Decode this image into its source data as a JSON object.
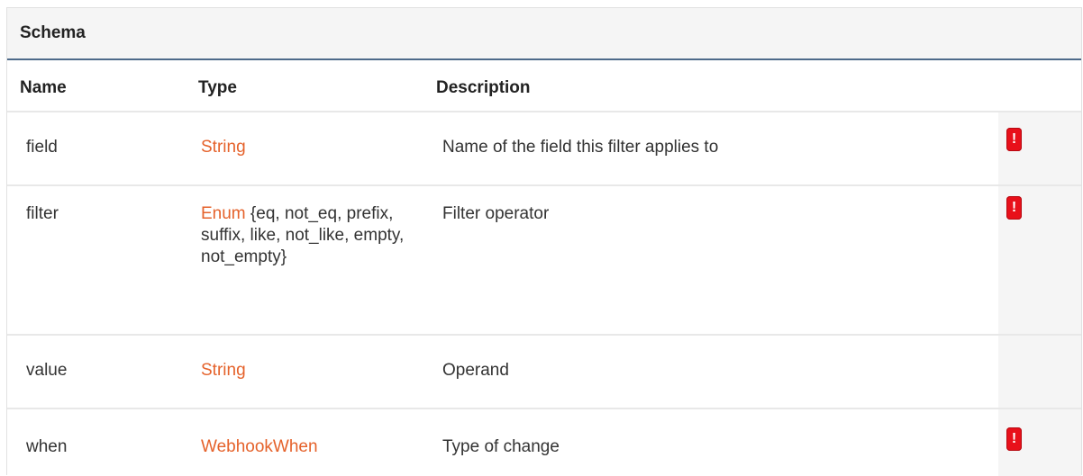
{
  "schema": {
    "title": "Schema",
    "columns": {
      "name": "Name",
      "type": "Type",
      "description": "Description"
    },
    "rows": [
      {
        "name": "field",
        "type_link": "String",
        "type_extra": "",
        "description": "Name of the field this filter applies to",
        "required_badge": "!"
      },
      {
        "name": "filter",
        "type_link": "Enum",
        "type_extra": " {eq, not_eq, prefix, suffix, like, not_like, empty, not_empty}",
        "description": "Filter operator",
        "required_badge": "!"
      },
      {
        "name": "value",
        "type_link": "String",
        "type_extra": "",
        "description": "Operand",
        "required_badge": ""
      },
      {
        "name": "when",
        "type_link": "WebhookWhen",
        "type_extra": "",
        "description": "Type of change",
        "required_badge": "!"
      }
    ]
  },
  "colors": {
    "type_link": "#e5622b",
    "badge": "#e8101a",
    "header_rule": "#4e6a8a"
  },
  "icons": {
    "required": "exclamation-badge-icon"
  }
}
